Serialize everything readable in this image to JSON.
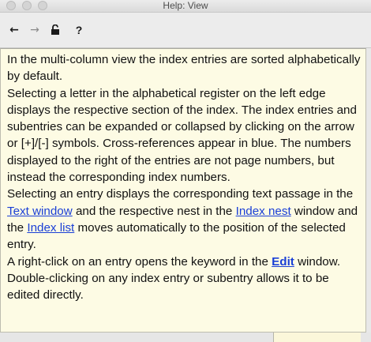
{
  "window": {
    "title": "Help: View"
  },
  "toolbar": {
    "back": {
      "icon": "left-arrow-icon",
      "glyph": "←"
    },
    "forward": {
      "icon": "right-arrow-icon",
      "glyph": "→"
    },
    "lock": {
      "icon": "unlock-icon",
      "glyph": "⊓"
    },
    "help": {
      "icon": "question-icon",
      "glyph": "?"
    }
  },
  "help": {
    "p1": "In the multi-column view the index entries are sorted alphabetically by default.",
    "p2": "Selecting a letter in the alphabetical register on the left edge displays the respective section of the index. The index entries and subentries can be expanded or collapsed by clicking on the arrow or [+]/[-] symbols. Cross-references appear in blue. The numbers displayed to the right of the entries are not page numbers, but instead the corresponding index numbers.",
    "p3_a": "Selecting an entry displays the corresponding text passage in the ",
    "p3_link1": "Text window",
    "p3_b": " and the respective nest in the ",
    "p3_link2": "Index nest",
    "p3_c": " window and the ",
    "p3_link3": "Index list",
    "p3_d": " moves automatically to the position of the selected entry.",
    "p4_a": "A right-click on an entry opens the keyword in the ",
    "p4_link": "Edit",
    "p4_b": " window.",
    "p5": "Double-clicking on any index entry or subentry allows it to be edited directly."
  },
  "colors": {
    "background": "#fdfbe4",
    "link": "#1a3fd6",
    "text": "#111111"
  }
}
